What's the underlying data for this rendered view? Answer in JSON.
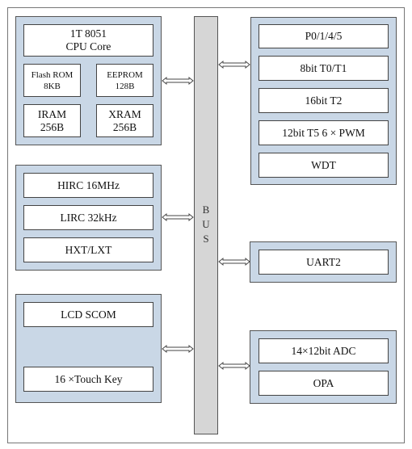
{
  "bus": {
    "label_letters": [
      "B",
      "U",
      "S"
    ]
  },
  "left_groups": {
    "cpu": {
      "core": "1T 8051\nCPU Core",
      "flash": "Flash ROM\n8KB",
      "eeprom": "EEPROM\n128B",
      "iram": "IRAM\n256B",
      "xram": "XRAM\n256B"
    },
    "clock": {
      "items": [
        "HIRC 16MHz",
        "LIRC 32kHz",
        "HXT/LXT"
      ]
    },
    "lcd_touch": {
      "items": [
        "LCD SCOM",
        "16 ×Touch Key"
      ]
    }
  },
  "right_groups": {
    "peripherals": {
      "items": [
        "P0/1/4/5",
        "8bit  T0/T1",
        "16bit  T2",
        "12bit T5  6 × PWM",
        "WDT"
      ]
    },
    "uart": {
      "items": [
        "UART2"
      ]
    },
    "analog": {
      "items": [
        "14×12bit ADC",
        "OPA"
      ]
    }
  },
  "colors": {
    "group_fill": "#c9d7e6",
    "bus_fill": "#d6d6d6"
  }
}
